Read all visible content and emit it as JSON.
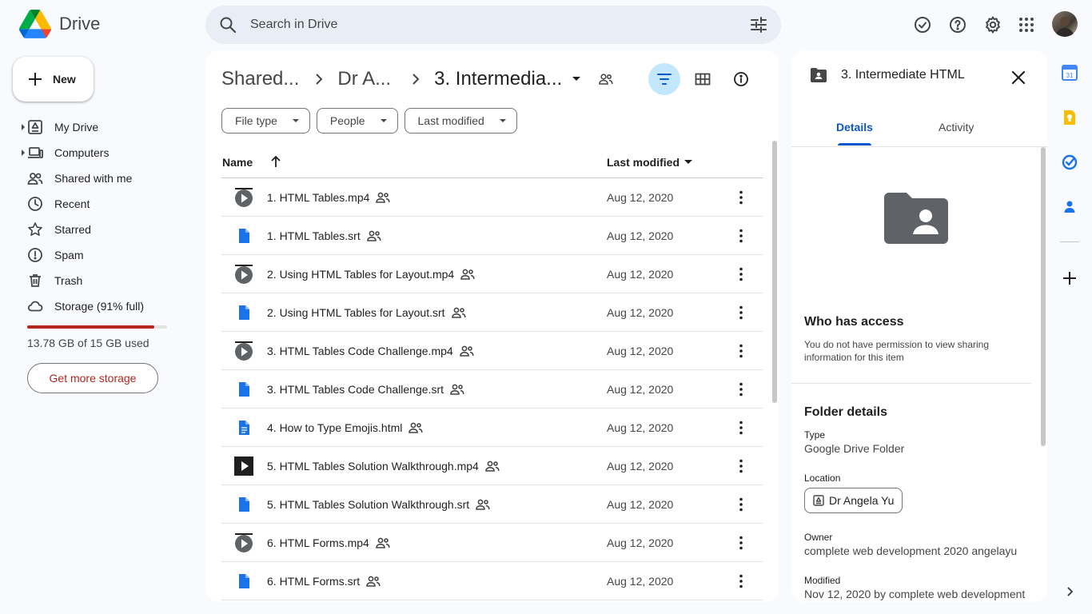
{
  "app": {
    "title": "Drive"
  },
  "search": {
    "placeholder": "Search in Drive"
  },
  "sidebar": {
    "new_label": "New",
    "items": [
      {
        "label": "My Drive",
        "icon": "my-drive-icon",
        "caret": true
      },
      {
        "label": "Computers",
        "icon": "computers-icon",
        "caret": true
      },
      {
        "label": "Shared with me",
        "icon": "shared-with-me-icon",
        "caret": false
      },
      {
        "label": "Recent",
        "icon": "clock-icon",
        "caret": false
      },
      {
        "label": "Starred",
        "icon": "star-icon",
        "caret": false
      },
      {
        "label": "Spam",
        "icon": "spam-icon",
        "caret": false
      },
      {
        "label": "Trash",
        "icon": "trash-icon",
        "caret": false
      },
      {
        "label": "Storage (91% full)",
        "icon": "cloud-icon",
        "caret": false
      }
    ],
    "storage": {
      "used_text": "13.78 GB of 15 GB used",
      "percent": 91,
      "bar_color": "#b3261e"
    },
    "get_more_storage": "Get more storage"
  },
  "main": {
    "breadcrumbs": [
      "Shared...",
      "Dr A...",
      "3. Intermedia..."
    ],
    "filters": [
      "File type",
      "People",
      "Last modified"
    ],
    "columns": {
      "name": "Name",
      "modified": "Last modified"
    },
    "files": [
      {
        "name": "1. HTML Tables.mp4",
        "type": "video",
        "modified": "Aug 12, 2020"
      },
      {
        "name": "1. HTML Tables.srt",
        "type": "doc",
        "modified": "Aug 12, 2020"
      },
      {
        "name": "2. Using HTML Tables for Layout.mp4",
        "type": "video",
        "modified": "Aug 12, 2020"
      },
      {
        "name": "2. Using HTML Tables for Layout.srt",
        "type": "doc",
        "modified": "Aug 12, 2020"
      },
      {
        "name": "3. HTML Tables Code Challenge.mp4",
        "type": "video",
        "modified": "Aug 12, 2020"
      },
      {
        "name": "3. HTML Tables Code Challenge.srt",
        "type": "doc",
        "modified": "Aug 12, 2020"
      },
      {
        "name": "4. How to Type Emojis.html",
        "type": "doc-lines",
        "modified": "Aug 12, 2020"
      },
      {
        "name": "5. HTML Tables Solution Walkthrough.mp4",
        "type": "video-dark",
        "modified": "Aug 12, 2020"
      },
      {
        "name": "5. HTML Tables Solution Walkthrough.srt",
        "type": "doc",
        "modified": "Aug 12, 2020"
      },
      {
        "name": "6. HTML Forms.mp4",
        "type": "video",
        "modified": "Aug 12, 2020"
      },
      {
        "name": "6. HTML Forms.srt",
        "type": "doc",
        "modified": "Aug 12, 2020"
      }
    ]
  },
  "details": {
    "title": "3. Intermediate HTML",
    "tabs": [
      "Details",
      "Activity"
    ],
    "access_heading": "Who has access",
    "access_text": "You do not have permission to view sharing information for this item",
    "folder_details_heading": "Folder details",
    "type_label": "Type",
    "type_value": "Google Drive Folder",
    "location_label": "Location",
    "location_value": "Dr Angela Yu",
    "owner_label": "Owner",
    "owner_value": "complete web development 2020 angelayu",
    "modified_label": "Modified",
    "modified_value": "Nov 12, 2020 by complete web development"
  },
  "colors": {
    "accent": "#0b57d0",
    "danger": "#b3261e",
    "selected_button": "#c2e7ff"
  }
}
